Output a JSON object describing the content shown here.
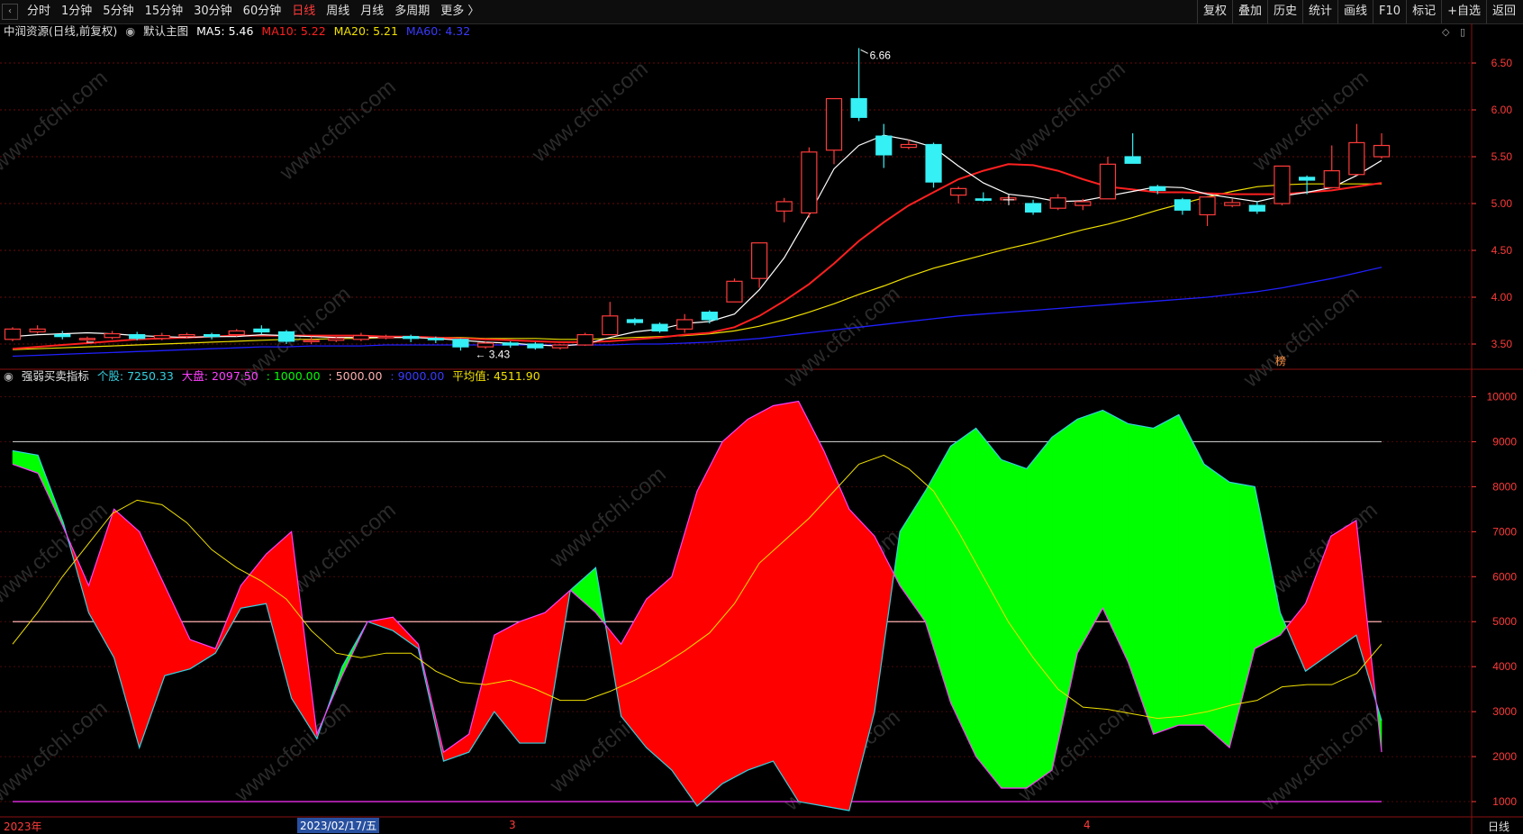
{
  "toolbar": {
    "back_icon": "chevron-left-icon",
    "periods": [
      "分时",
      "1分钟",
      "5分钟",
      "15分钟",
      "30分钟",
      "60分钟",
      "日线",
      "周线",
      "月线",
      "多周期",
      "更多 〉"
    ],
    "active_period": "日线",
    "right_buttons": [
      "复权",
      "叠加",
      "历史",
      "统计",
      "画线",
      "F10",
      "标记",
      "+自选",
      "返回"
    ]
  },
  "main_legend": {
    "title": "中润资源(日线,前复权)",
    "chart_name": "默认主图",
    "ma5_label": "MA5: 5.46",
    "ma10_label": "MA10: 5.22",
    "ma20_label": "MA20: 5.21",
    "ma60_label": "MA60: 4.32"
  },
  "sub_legend": {
    "title": "强弱买卖指标",
    "stock_label": "个股: 7250.33",
    "market_label": "大盘: 2097.50",
    "l1_label": ": 1000.00",
    "l2_label": ": 5000.00",
    "l3_label": ": 9000.00",
    "avg_label": "平均值: 4511.90"
  },
  "annotations": {
    "high": "6.66",
    "low": "3.43",
    "badge": "榜"
  },
  "date_axis": {
    "year": "2023年",
    "cursor_date": "2023/02/17/五",
    "mar": "3",
    "apr": "4",
    "period": "日线"
  },
  "watermark": "www.cfchi.com",
  "colors": {
    "up": "#ff3b3b",
    "down": "#35f0f5",
    "ma5": "#ffffff",
    "ma10": "#ff2020",
    "ma20": "#f0e000",
    "ma60": "#2020ff",
    "fill_red": "#ff0000",
    "fill_green": "#00ff00",
    "avg": "#f0e000"
  },
  "chart_data": [
    {
      "type": "candlestick",
      "title": "中润资源(日线,前复权)",
      "y_ticks": [
        3.5,
        4.0,
        4.5,
        5.0,
        5.5,
        6.0,
        6.5
      ],
      "ylim": [
        3.25,
        6.75
      ],
      "candles": [
        [
          3.55,
          3.66,
          3.68,
          3.53
        ],
        [
          3.63,
          3.66,
          3.7,
          3.61
        ],
        [
          3.6,
          3.58,
          3.64,
          3.55
        ],
        [
          3.56,
          3.56,
          3.58,
          3.52
        ],
        [
          3.57,
          3.61,
          3.64,
          3.55
        ],
        [
          3.6,
          3.56,
          3.63,
          3.54
        ],
        [
          3.56,
          3.59,
          3.62,
          3.54
        ],
        [
          3.58,
          3.6,
          3.62,
          3.56
        ],
        [
          3.6,
          3.58,
          3.62,
          3.55
        ],
        [
          3.6,
          3.64,
          3.66,
          3.58
        ],
        [
          3.66,
          3.63,
          3.7,
          3.6
        ],
        [
          3.63,
          3.53,
          3.65,
          3.5
        ],
        [
          3.53,
          3.54,
          3.58,
          3.5
        ],
        [
          3.54,
          3.56,
          3.58,
          3.52
        ],
        [
          3.55,
          3.59,
          3.62,
          3.53
        ],
        [
          3.58,
          3.58,
          3.6,
          3.55
        ],
        [
          3.58,
          3.56,
          3.6,
          3.52
        ],
        [
          3.56,
          3.55,
          3.58,
          3.51
        ],
        [
          3.55,
          3.47,
          3.56,
          3.43
        ],
        [
          3.47,
          3.51,
          3.53,
          3.45
        ],
        [
          3.51,
          3.49,
          3.53,
          3.46
        ],
        [
          3.5,
          3.46,
          3.52,
          3.44
        ],
        [
          3.46,
          3.49,
          3.5,
          3.44
        ],
        [
          3.49,
          3.6,
          3.62,
          3.48
        ],
        [
          3.6,
          3.8,
          3.95,
          3.6
        ],
        [
          3.76,
          3.73,
          3.78,
          3.7
        ],
        [
          3.71,
          3.64,
          3.73,
          3.62
        ],
        [
          3.66,
          3.76,
          3.82,
          3.62
        ],
        [
          3.84,
          3.76,
          3.86,
          3.72
        ],
        [
          3.95,
          4.17,
          4.2,
          3.95
        ],
        [
          4.2,
          4.58,
          4.58,
          4.1
        ],
        [
          4.92,
          5.02,
          5.06,
          4.8
        ],
        [
          4.9,
          5.55,
          5.6,
          4.85
        ],
        [
          5.57,
          6.12,
          6.12,
          5.42
        ],
        [
          6.12,
          5.92,
          6.66,
          5.88
        ],
        [
          5.72,
          5.52,
          5.85,
          5.38
        ],
        [
          5.6,
          5.63,
          5.68,
          5.58
        ],
        [
          5.63,
          5.23,
          5.65,
          5.17
        ],
        [
          5.09,
          5.16,
          5.18,
          5.0
        ],
        [
          5.05,
          5.04,
          5.12,
          5.02
        ],
        [
          5.04,
          5.06,
          5.08,
          5.03
        ],
        [
          5.0,
          4.91,
          5.04,
          4.88
        ],
        [
          4.95,
          5.06,
          5.1,
          4.93
        ],
        [
          4.98,
          5.02,
          5.05,
          4.93
        ],
        [
          5.05,
          5.42,
          5.5,
          5.05
        ],
        [
          5.5,
          5.43,
          5.75,
          5.43
        ],
        [
          5.18,
          5.14,
          5.2,
          5.1
        ],
        [
          5.04,
          4.93,
          5.06,
          4.88
        ],
        [
          4.88,
          5.07,
          5.08,
          4.76
        ],
        [
          4.98,
          5.01,
          5.05,
          4.96
        ],
        [
          4.98,
          4.92,
          5.02,
          4.89
        ],
        [
          5.0,
          5.4,
          5.4,
          4.98
        ],
        [
          5.28,
          5.25,
          5.3,
          5.1
        ],
        [
          5.17,
          5.35,
          5.62,
          5.16
        ],
        [
          5.31,
          5.65,
          5.85,
          5.3
        ],
        [
          5.5,
          5.62,
          5.75,
          5.48
        ]
      ],
      "ma5": [
        3.58,
        3.6,
        3.61,
        3.62,
        3.61,
        3.59,
        3.58,
        3.57,
        3.58,
        3.58,
        3.6,
        3.59,
        3.58,
        3.57,
        3.57,
        3.57,
        3.57,
        3.56,
        3.54,
        3.52,
        3.51,
        3.49,
        3.48,
        3.5,
        3.57,
        3.63,
        3.66,
        3.72,
        3.74,
        3.82,
        4.08,
        4.42,
        4.88,
        5.37,
        5.62,
        5.73,
        5.68,
        5.6,
        5.4,
        5.22,
        5.1,
        5.07,
        5.02,
        5.03,
        5.08,
        5.13,
        5.18,
        5.17,
        5.1,
        5.06,
        5.02,
        5.08,
        5.12,
        5.17,
        5.3,
        5.46
      ],
      "ma10": [
        3.45,
        3.47,
        3.49,
        3.51,
        3.53,
        3.55,
        3.56,
        3.57,
        3.58,
        3.59,
        3.59,
        3.59,
        3.59,
        3.59,
        3.59,
        3.58,
        3.58,
        3.57,
        3.56,
        3.55,
        3.54,
        3.53,
        3.52,
        3.52,
        3.53,
        3.55,
        3.57,
        3.6,
        3.62,
        3.68,
        3.8,
        3.96,
        4.14,
        4.36,
        4.6,
        4.8,
        4.98,
        5.12,
        5.26,
        5.35,
        5.42,
        5.41,
        5.35,
        5.26,
        5.18,
        5.15,
        5.12,
        5.12,
        5.11,
        5.1,
        5.1,
        5.1,
        5.12,
        5.14,
        5.18,
        5.22
      ],
      "ma20": [
        3.44,
        3.45,
        3.46,
        3.47,
        3.48,
        3.49,
        3.5,
        3.51,
        3.52,
        3.53,
        3.54,
        3.55,
        3.55,
        3.56,
        3.56,
        3.57,
        3.57,
        3.57,
        3.57,
        3.56,
        3.56,
        3.56,
        3.55,
        3.55,
        3.56,
        3.57,
        3.58,
        3.59,
        3.61,
        3.64,
        3.69,
        3.76,
        3.84,
        3.93,
        4.03,
        4.12,
        4.22,
        4.31,
        4.38,
        4.45,
        4.52,
        4.58,
        4.65,
        4.72,
        4.78,
        4.85,
        4.93,
        5.0,
        5.07,
        5.13,
        5.18,
        5.2,
        5.21,
        5.21,
        5.21,
        5.21
      ],
      "ma60": [
        3.37,
        3.38,
        3.39,
        3.4,
        3.41,
        3.42,
        3.43,
        3.44,
        3.45,
        3.46,
        3.47,
        3.47,
        3.48,
        3.48,
        3.48,
        3.49,
        3.49,
        3.49,
        3.49,
        3.49,
        3.49,
        3.49,
        3.49,
        3.49,
        3.49,
        3.5,
        3.5,
        3.51,
        3.52,
        3.54,
        3.56,
        3.59,
        3.62,
        3.65,
        3.68,
        3.71,
        3.74,
        3.77,
        3.8,
        3.82,
        3.84,
        3.86,
        3.88,
        3.9,
        3.92,
        3.94,
        3.96,
        3.98,
        4.0,
        4.03,
        4.06,
        4.1,
        4.15,
        4.2,
        4.26,
        4.32
      ]
    },
    {
      "type": "area",
      "title": "强弱买卖指标",
      "y_ticks": [
        1000,
        2000,
        3000,
        4000,
        5000,
        6000,
        7000,
        8000,
        9000,
        10000
      ],
      "ylim": [
        700,
        10250
      ],
      "ref_lines": [
        1000,
        5000,
        9000
      ],
      "series": [
        {
          "name": "个股",
          "values": [
            8800,
            8700,
            7200,
            5200,
            4200,
            2200,
            3800,
            3950,
            4300,
            5300,
            5400,
            3300,
            2400,
            4000,
            5000,
            4800,
            4400,
            1900,
            2100,
            3000,
            2300,
            2300,
            5700,
            6200,
            2900,
            2200,
            1700,
            900,
            1400,
            1700,
            1900,
            1000,
            900,
            800,
            3000,
            7000,
            7900,
            8900,
            9300,
            8600,
            8400,
            9100,
            9500,
            9700,
            9400,
            9300,
            9600,
            8500,
            8100,
            8000,
            5200,
            3900,
            4300,
            4700,
            2800,
            2100,
            7250
          ]
        },
        {
          "name": "大盘",
          "values": [
            8500,
            8300,
            7100,
            5800,
            7500,
            7000,
            5800,
            4600,
            4400,
            5800,
            6500,
            7000,
            2500,
            3800,
            5000,
            5100,
            4500,
            2100,
            2500,
            4700,
            5000,
            5200,
            5700,
            5200,
            4500,
            5500,
            6000,
            7900,
            9000,
            9500,
            9800,
            9900,
            8800,
            7500,
            6900,
            5800,
            5000,
            3200,
            2000,
            1300,
            1300,
            1700,
            4300,
            5300,
            4100,
            2500,
            2700,
            2700,
            2200,
            4400,
            4700,
            5400,
            6900,
            7250,
            2100
          ]
        },
        {
          "name": "平均值",
          "values": [
            4500,
            5200,
            6000,
            6700,
            7400,
            7700,
            7600,
            7200,
            6600,
            6200,
            5900,
            5500,
            4800,
            4300,
            4200,
            4300,
            4300,
            3900,
            3650,
            3600,
            3700,
            3500,
            3250,
            3250,
            3450,
            3700,
            4000,
            4350,
            4750,
            5400,
            6300,
            6800,
            7300,
            7900,
            8500,
            8700,
            8400,
            7900,
            7000,
            6000,
            5000,
            4200,
            3500,
            3100,
            3050,
            2950,
            2850,
            2900,
            3000,
            3150,
            3250,
            3550,
            3600,
            3600,
            3850,
            4500
          ]
        }
      ]
    }
  ]
}
